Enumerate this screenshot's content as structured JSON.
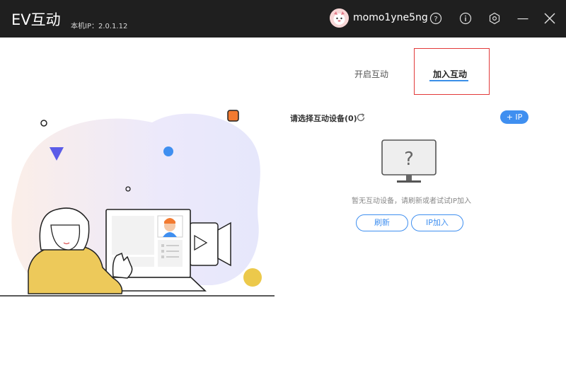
{
  "titlebar": {
    "app_title": "EV互动",
    "local_ip": "本机IP：2.0.1.12",
    "username": "momo1yne5ng",
    "icons": [
      "help-icon",
      "info-icon",
      "settings-icon",
      "minimize-icon",
      "close-icon"
    ]
  },
  "tabs": {
    "start": "开启互动",
    "join": "加入互动"
  },
  "device_panel": {
    "title": "请选择互动设备(0)",
    "ip_button": "+ IP",
    "empty_text": "暂无互动设备，请刷新或者试试IP加入",
    "refresh_button": "刷新",
    "ip_join_button": "IP加入"
  },
  "colors": {
    "titlebar_bg": "#1f1f1f",
    "accent": "#3f8ff0",
    "highlight": "#e23a3a"
  }
}
